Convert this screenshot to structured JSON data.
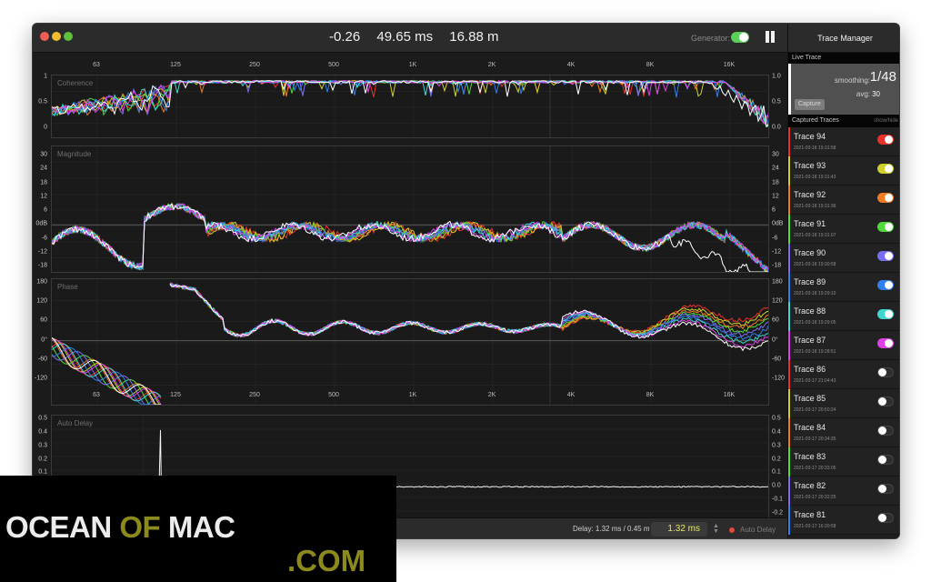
{
  "window": {
    "readouts": [
      "-0.26",
      "49.65 ms",
      "16.88 m"
    ],
    "generator_label": "Generator:",
    "generator_on": true,
    "pause_icon": "pause-icon"
  },
  "frequency_ticks": [
    "63",
    "125",
    "250",
    "500",
    "1K",
    "2K",
    "4K",
    "8K",
    "16K"
  ],
  "coherence": {
    "title": "Coherence",
    "left_ticks": [
      "1",
      "0.5",
      "0"
    ],
    "right_ticks": [
      "1.0",
      "0.5",
      "0.0"
    ]
  },
  "magnitude": {
    "title": "Magnitude",
    "ticks": [
      "30",
      "24",
      "18",
      "12",
      "6",
      "0dB",
      "-6",
      "-12",
      "-18"
    ]
  },
  "phase": {
    "title": "Phase",
    "ticks": [
      "180",
      "120",
      "60",
      "0°",
      "-60",
      "-120"
    ]
  },
  "auto_delay": {
    "title": "Auto Delay",
    "ticks": [
      "0.5",
      "0.4",
      "0.3",
      "0.2",
      "0.1",
      "0.0",
      "-0.1",
      "-0.2"
    ]
  },
  "statusbar": {
    "delay_text": "Delay: 1.32 ms / 0.45 m",
    "delay_value": "1.32 ms",
    "auto_delay_label": "Auto Delay",
    "auto_delay_color": "#e24a3d"
  },
  "sidebar": {
    "title": "Trace Manager",
    "live_trace_label": "Live Trace",
    "smoothing_label": "smoothing:",
    "smoothing_value": "1/48",
    "avg_label": "avg:",
    "avg_value": "30",
    "capture_label": "Capture",
    "captured_label": "Captured Traces",
    "showhide_label": "show/hide",
    "traces": [
      {
        "name": "Trace 94",
        "date": "2021-03-18 19:31:58",
        "color": "#e8312a",
        "on": true
      },
      {
        "name": "Trace 93",
        "date": "2021-03-18 19:31:43",
        "color": "#cfcf2b",
        "on": true
      },
      {
        "name": "Trace 92",
        "date": "2021-03-18 19:31:36",
        "color": "#f07b23",
        "on": true
      },
      {
        "name": "Trace 91",
        "date": "2021-03-18 19:31:07",
        "color": "#4fdc3a",
        "on": true
      },
      {
        "name": "Trace 90",
        "date": "2021-03-18 19:30:58",
        "color": "#7a6ef0",
        "on": true
      },
      {
        "name": "Trace 89",
        "date": "2021-03-18 19:29:10",
        "color": "#2f7ff0",
        "on": true
      },
      {
        "name": "Trace 88",
        "date": "2021-03-18 19:29:05",
        "color": "#3fd6cf",
        "on": true
      },
      {
        "name": "Trace 87",
        "date": "2021-03-18 19:28:51",
        "color": "#e03ee6",
        "on": true
      },
      {
        "name": "Trace 86",
        "date": "2021-03-17 21:04:43",
        "color": "#e8312a",
        "on": false
      },
      {
        "name": "Trace 85",
        "date": "2021-03-17 20:50:24",
        "color": "#cfcf2b",
        "on": false
      },
      {
        "name": "Trace 84",
        "date": "2021-03-17 20:34:35",
        "color": "#f07b23",
        "on": false
      },
      {
        "name": "Trace 83",
        "date": "2021-03-17 20:33:05",
        "color": "#4fdc3a",
        "on": false
      },
      {
        "name": "Trace 82",
        "date": "2021-03-17 20:32:25",
        "color": "#7a6ef0",
        "on": false
      },
      {
        "name": "Trace 81",
        "date": "2021-03-17 16:30:58",
        "color": "#2f7ff0",
        "on": false
      }
    ]
  },
  "watermark": {
    "ocean": "OCEAN",
    "of": "OF",
    "mac": "MAC",
    "com": ".COM"
  }
}
